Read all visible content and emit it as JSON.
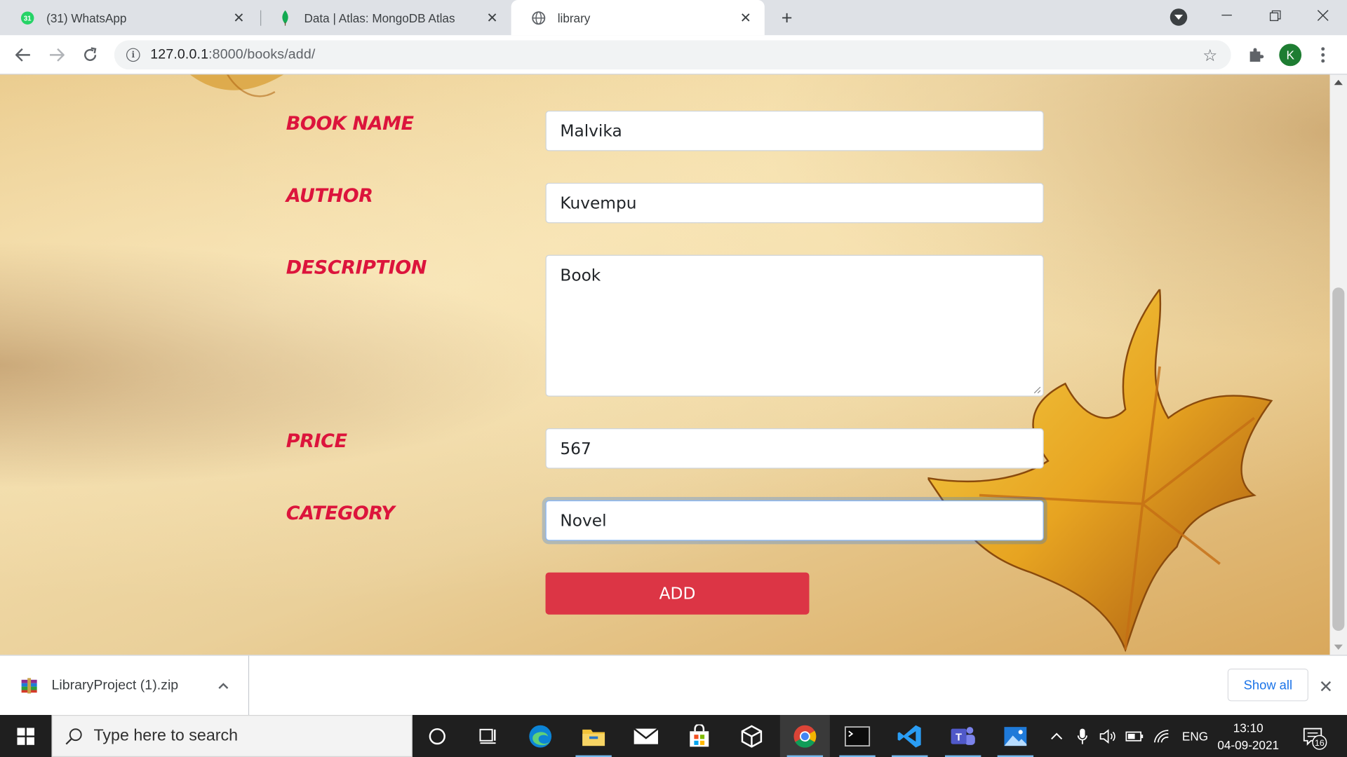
{
  "browser": {
    "tabs": [
      {
        "title": "(31) WhatsApp",
        "badge": "31"
      },
      {
        "title": "Data | Atlas: MongoDB Atlas"
      },
      {
        "title": "library"
      }
    ],
    "url_host": "127.0.0.1",
    "url_rest": ":8000/books/add/",
    "profile_initial": "K"
  },
  "form": {
    "book_name_label": "BOOK NAME",
    "book_name_value": "Malvika",
    "author_label": "AUTHOR",
    "author_value": "Kuvempu",
    "description_label": "DESCRIPTION",
    "description_value": "Book",
    "price_label": "PRICE",
    "price_value": "567",
    "category_label": "CATEGORY",
    "category_value": "Novel",
    "submit_label": "ADD"
  },
  "downloads": {
    "file_name": "LibraryProject (1).zip",
    "show_all": "Show all"
  },
  "taskbar": {
    "search_placeholder": "Type here to search",
    "language": "ENG",
    "time": "13:10",
    "date": "04-09-2021",
    "notifications": "16"
  },
  "colors": {
    "label": "#dc143c",
    "button": "#dc3545"
  }
}
